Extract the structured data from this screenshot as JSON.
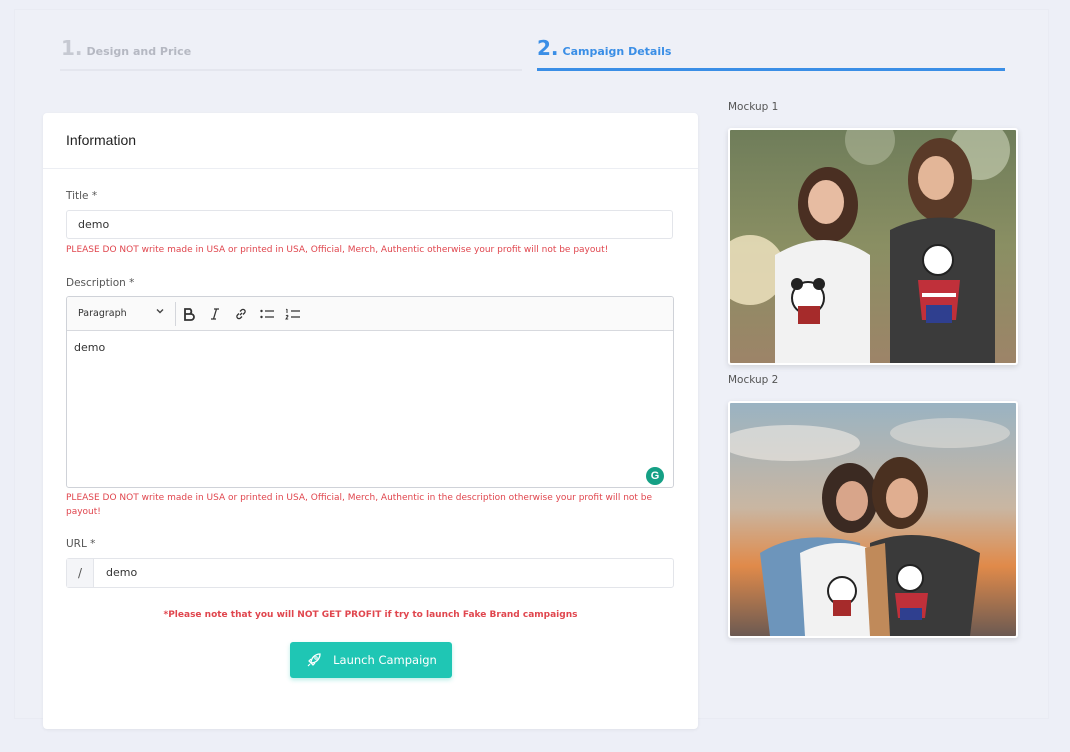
{
  "stepper": {
    "step1": {
      "number": "1.",
      "label": "Design and Price"
    },
    "step2": {
      "number": "2.",
      "label": "Campaign Details"
    }
  },
  "card": {
    "title": "Information",
    "title_field": {
      "label": "Title *",
      "value": "demo",
      "warning": "PLEASE DO NOT write made in USA or printed in USA, Official, Merch, Authentic otherwise your profit will not be payout!"
    },
    "description_field": {
      "label": "Description *",
      "paragraph_select": "Paragraph",
      "value": "demo",
      "warning": "PLEASE DO NOT write made in USA or printed in USA, Official, Merch, Authentic in the description otherwise your profit will not be payout!"
    },
    "url_field": {
      "label": "URL *",
      "prefix": "/",
      "value": "demo"
    },
    "fake_brand_note": "*Please note that you will NOT GET PROFIT if try to launch Fake Brand campaigns",
    "launch_button": "Launch Campaign"
  },
  "mockups": [
    {
      "label": "Mockup 1"
    },
    {
      "label": "Mockup 2"
    }
  ],
  "colors": {
    "accent": "#3a8ee6",
    "launch": "#1fc6b4",
    "warning": "#e0464e",
    "grammarly": "#15a085"
  },
  "icons": {
    "bold": "bold-icon",
    "italic": "italic-icon",
    "link": "link-icon",
    "bulleted_list": "bulleted-list-icon",
    "numbered_list": "numbered-list-icon",
    "rocket": "rocket-icon",
    "grammarly": "grammarly-icon",
    "paragraph_chevron": "chevron-down-icon"
  }
}
